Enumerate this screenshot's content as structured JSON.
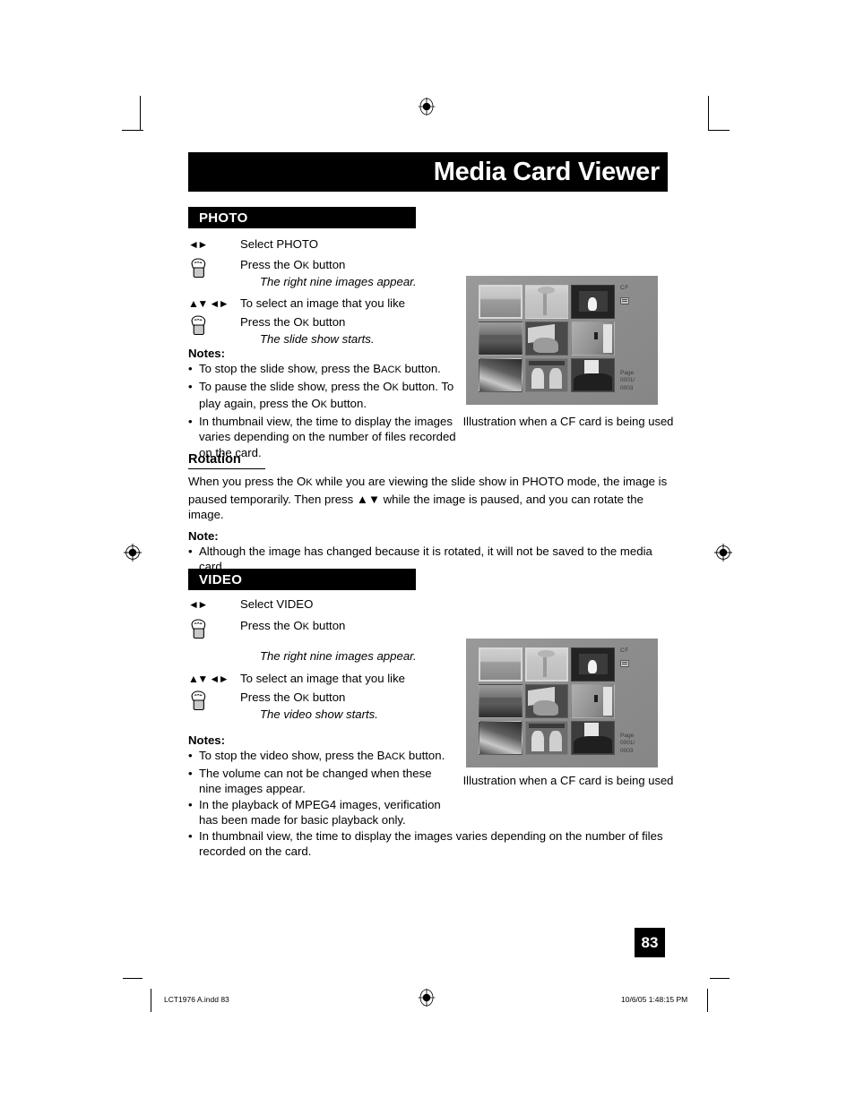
{
  "page": {
    "title": "Media Card Viewer",
    "page_number": "83"
  },
  "photo": {
    "section_label": "PHOTO",
    "steps": [
      {
        "glyph": "arrows-lr",
        "label": "Select PHOTO"
      },
      {
        "glyph": "hand-press",
        "label": "Press the Ok button",
        "result": "The right nine images appear."
      },
      {
        "glyph": "arrows-udlr",
        "label": "To select an image that you like"
      },
      {
        "glyph": "hand-press",
        "label": "Press the Ok button",
        "result": "The slide show starts."
      }
    ],
    "notes_title": "Notes:",
    "notes": [
      "To stop the slide show, press the Back button.",
      "To pause the slide show, press the Ok button. To play again, press the Ok button.",
      "In thumbnail view, the time to display the images varies depending on the number of files recorded on the card."
    ]
  },
  "rotation": {
    "heading": "Rotation",
    "body": "When you press the Ok while you are viewing the slide show in PHOTO mode, the image is paused temporarily.  Then press ▲▼ while the image is paused, and you can rotate the image.",
    "note_title": "Note:",
    "notes": [
      "Although the image has changed because it is rotated, it will not be saved to the media card."
    ]
  },
  "video": {
    "section_label": "VIDEO",
    "steps": [
      {
        "glyph": "arrows-lr",
        "label": "Select VIDEO"
      },
      {
        "glyph": "hand-press",
        "label": "Press the Ok button",
        "result": "The right nine images appear."
      },
      {
        "glyph": "arrows-udlr",
        "label": "To select an image that you like"
      },
      {
        "glyph": "hand-press",
        "label": "Press the Ok button",
        "result": "The video show starts."
      }
    ],
    "notes_title": "Notes:",
    "notes": [
      "To stop the video show, press the Back button.",
      "The volume can not be changed when these nine images appear.",
      "In the playback of MPEG4 images, verification has been made for basic playback only.",
      "In thumbnail view, the time to display the images varies depending on the number of files recorded on the card."
    ]
  },
  "illustrations": {
    "caption": "Illustration when a CF card is being used",
    "card_label": "CF",
    "page_indicator_line1": "Page",
    "page_indicator_line2": "0001/",
    "page_indicator_line3": "0003",
    "thumbnails": [
      "seascape-horizon",
      "tree-on-hill",
      "fireplace-fire",
      "coastal-bay",
      "dog-on-couch",
      "rock-climber",
      "river-rapids",
      "garden-arbor",
      "people-indoors"
    ]
  },
  "footer": {
    "file_ref": "LCT1976 A.indd   83",
    "timestamp": "10/6/05   1:48:15 PM"
  }
}
